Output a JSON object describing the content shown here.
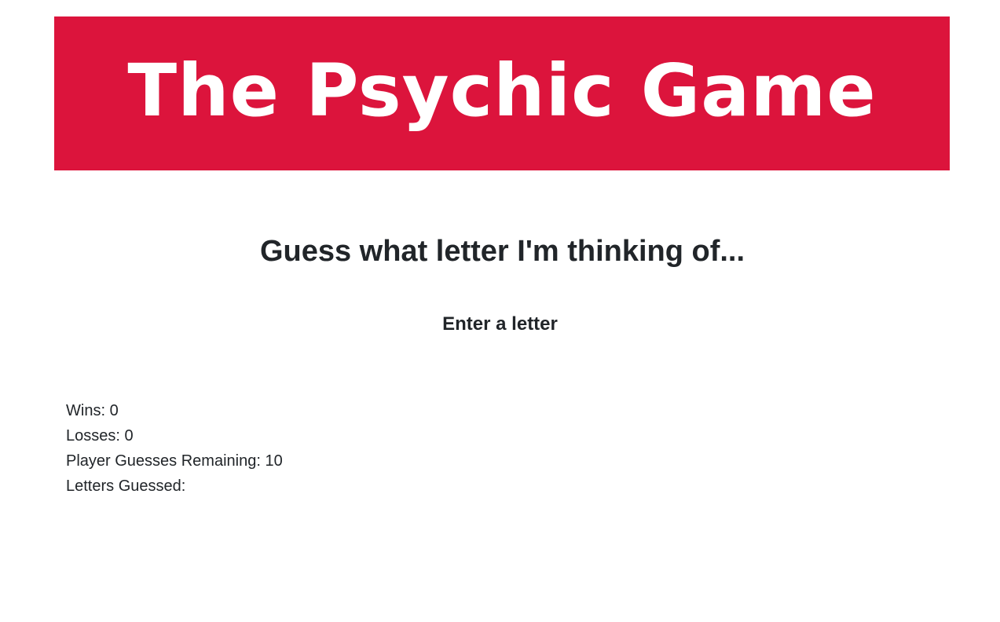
{
  "banner": {
    "title": "The Psychic Game",
    "background_color": "#dc143c"
  },
  "main": {
    "heading": "Guess what letter I'm thinking of...",
    "instruction": "Enter a letter"
  },
  "stats": {
    "wins_label": "Wins:",
    "wins_value": "0",
    "losses_label": "Losses:",
    "losses_value": "0",
    "guesses_remaining_label": "Player Guesses Remaining:",
    "guesses_remaining_value": "10",
    "letters_guessed_label": "Letters Guessed:",
    "letters_guessed_value": ""
  }
}
